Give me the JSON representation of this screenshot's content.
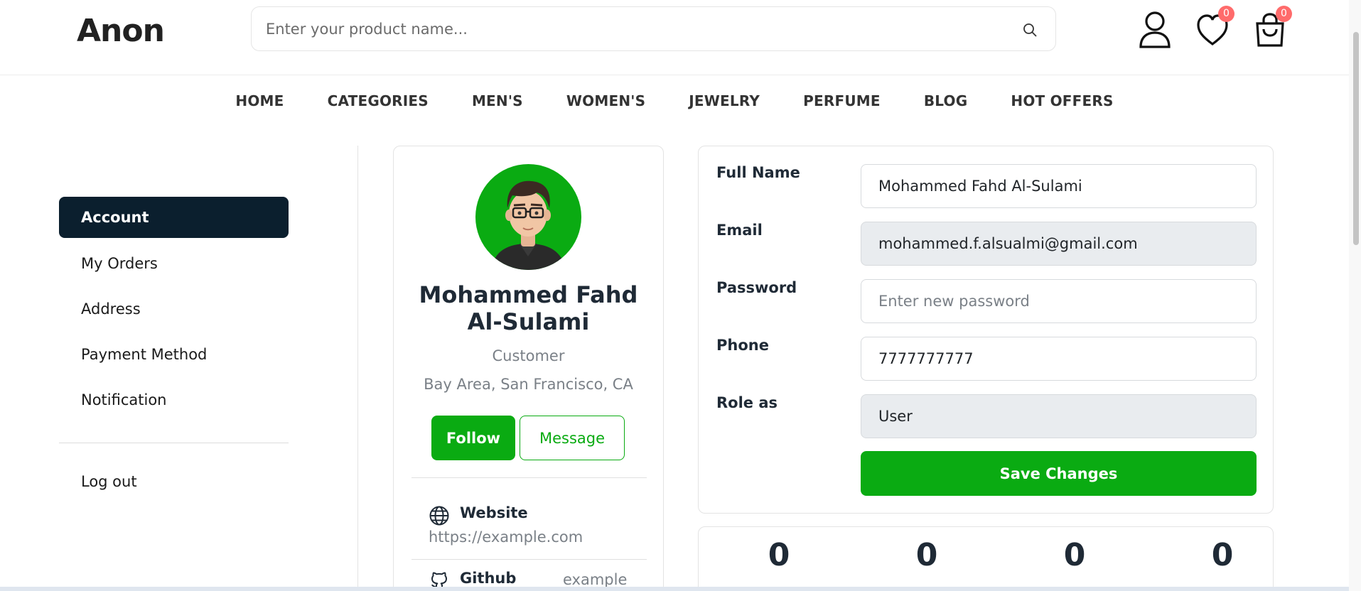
{
  "header": {
    "logo": "Anon",
    "search_placeholder": "Enter your product name...",
    "wishlist_count": "0",
    "cart_count": "0"
  },
  "nav": {
    "items": [
      "HOME",
      "CATEGORIES",
      "MEN'S",
      "WOMEN'S",
      "JEWELRY",
      "PERFUME",
      "BLOG",
      "HOT OFFERS"
    ]
  },
  "sidebar": {
    "items": [
      "Account",
      "My Orders",
      "Address",
      "Payment Method",
      "Notification"
    ],
    "active": "Account",
    "logout": "Log out"
  },
  "profile": {
    "name_line1": "Mohammed Fahd",
    "name_line2": "Al-Sulami",
    "role": "Customer",
    "location": "Bay Area, San Francisco, CA",
    "follow_label": "Follow",
    "message_label": "Message",
    "links": [
      {
        "label": "Website",
        "value": "https://example.com"
      },
      {
        "label": "Github",
        "value": "example"
      }
    ]
  },
  "form": {
    "full_name_label": "Full Name",
    "full_name_value": "Mohammed Fahd Al-Sulami",
    "email_label": "Email",
    "email_value": "mohammed.f.alsualmi@gmail.com",
    "password_label": "Password",
    "password_placeholder": "Enter new password",
    "phone_label": "Phone",
    "phone_value": "7777777777",
    "role_label": "Role as",
    "role_value": "User",
    "save_label": "Save Changes"
  },
  "stats": [
    "0",
    "0",
    "0",
    "0"
  ],
  "colors": {
    "accent_green": "#0aab12",
    "sidebar_active": "#0b1f2e",
    "badge": "#ff6b6b"
  }
}
